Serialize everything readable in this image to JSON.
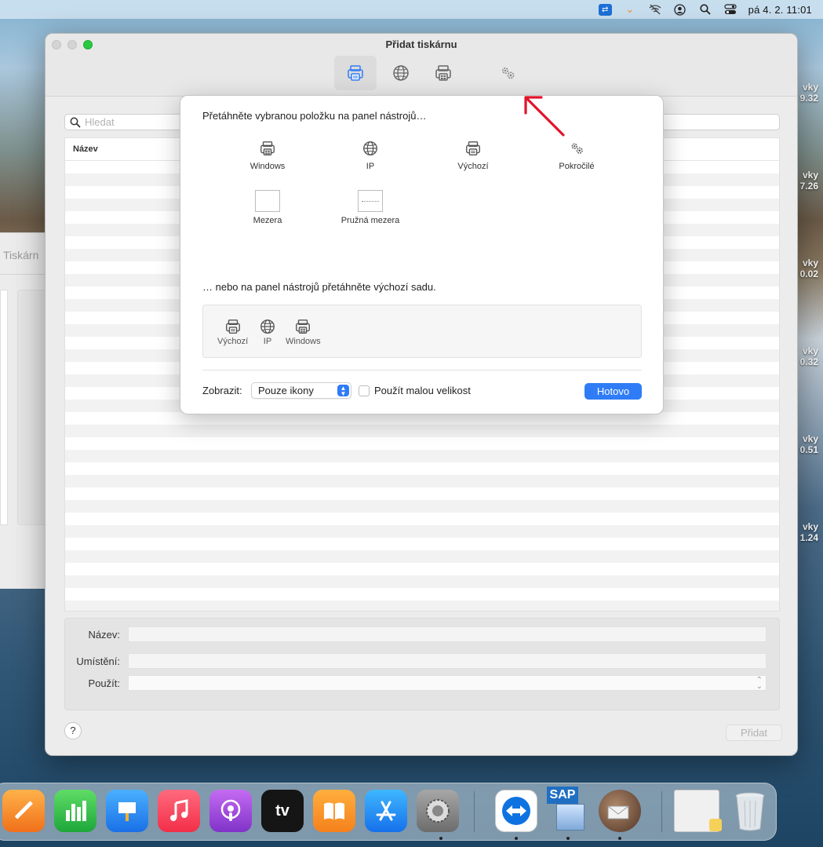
{
  "menubar": {
    "clock": "pá 4. 2.  11:01",
    "icons": [
      "teamviewer-icon",
      "app-chevron-icon",
      "wifi-off-icon",
      "user-icon",
      "search-icon",
      "control-center-icon"
    ]
  },
  "desktop": {
    "widget_labels": [
      {
        "title": "vky",
        "value": "9.32"
      },
      {
        "title": "vky",
        "value": "7.26"
      },
      {
        "title": "vky",
        "value": "0.02"
      },
      {
        "title": "vky",
        "value": "0.32"
      },
      {
        "title": "vky",
        "value": "0.51"
      },
      {
        "title": "vky",
        "value": "1.24"
      }
    ],
    "background_window_title": "Tiskárn"
  },
  "window": {
    "title": "Přidat tiskárnu",
    "toolbar": [
      "default-printer-icon",
      "ip-globe-icon",
      "windows-printer-icon",
      "advanced-gears-icon"
    ],
    "search_placeholder": "Hledat",
    "table_header": "Název",
    "form": {
      "name_label": "Název:",
      "location_label": "Umístění:",
      "use_label": "Použít:"
    },
    "help_label": "?",
    "add_label": "Přidat"
  },
  "sheet": {
    "heading": "Přetáhněte vybranou položku na panel nástrojů…",
    "palette": [
      {
        "label": "Windows",
        "icon": "printer-icon"
      },
      {
        "label": "IP",
        "icon": "globe-icon"
      },
      {
        "label": "Výchozí",
        "icon": "printer-icon"
      },
      {
        "label": "Pokročilé",
        "icon": "gears-icon"
      },
      {
        "label": "Mezera",
        "icon": "space-box"
      },
      {
        "label": "Pružná mezera",
        "icon": "flexible-space-box"
      }
    ],
    "default_set_heading": "… nebo na panel nástrojů přetáhněte výchozí sadu.",
    "default_set": [
      {
        "label": "Výchozí",
        "icon": "printer-icon"
      },
      {
        "label": "IP",
        "icon": "globe-icon"
      },
      {
        "label": "Windows",
        "icon": "printer-icon"
      }
    ],
    "show_label": "Zobrazit:",
    "show_value": "Pouze ikony",
    "small_size_label": "Použít malou velikost",
    "small_size_checked": false,
    "done_label": "Hotovo"
  },
  "annotation": {
    "arrow_color": "#e0142a"
  },
  "dock": {
    "apps": [
      {
        "name": "pages",
        "label": "",
        "color": "#f58a1f"
      },
      {
        "name": "numbers",
        "label": "",
        "color": "#2fb84a"
      },
      {
        "name": "keynote",
        "label": "",
        "color": "#2a8df0"
      },
      {
        "name": "music",
        "label": "",
        "color": "#f6425a"
      },
      {
        "name": "podcasts",
        "label": "",
        "color": "#9b4bd6"
      },
      {
        "name": "apple-tv",
        "label": "tv",
        "color": "#1b1b1b"
      },
      {
        "name": "books",
        "label": "",
        "color": "#f7921d"
      },
      {
        "name": "app-store",
        "label": "",
        "color": "#1d8df5"
      },
      {
        "name": "system-preferences",
        "label": "",
        "color": "#8c8c8c"
      },
      {
        "name": "teamviewer",
        "label": "",
        "color": "#0e73e0"
      },
      {
        "name": "sap",
        "label": "SAP",
        "color": "#2a6fbf"
      },
      {
        "name": "mail-app",
        "label": "",
        "color": "#7a5b3f"
      },
      {
        "name": "preview-window",
        "label": "",
        "color": "#e9e9e9"
      },
      {
        "name": "trash",
        "label": "",
        "color": "#cfd6dc"
      }
    ]
  }
}
